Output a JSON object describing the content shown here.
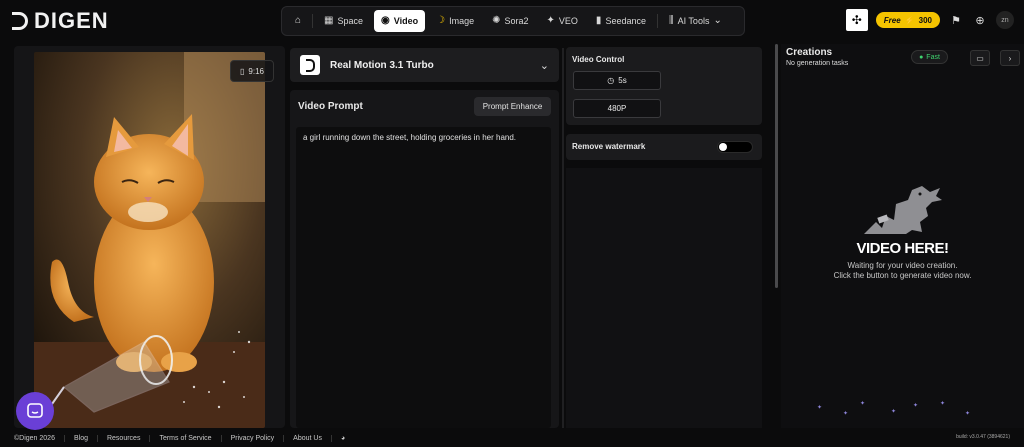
{
  "brand": {
    "name": "DIGEN"
  },
  "nav": {
    "items": [
      {
        "label": "",
        "icon": "home-icon"
      },
      {
        "label": "Space",
        "icon": "grid-icon"
      },
      {
        "label": "Video",
        "icon": "video-icon",
        "active": true
      },
      {
        "label": "Image",
        "icon": "banana-icon"
      },
      {
        "label": "Sora2",
        "icon": "sora-icon"
      },
      {
        "label": "VEO",
        "icon": "veo-icon"
      },
      {
        "label": "Seedance",
        "icon": "bars-icon"
      },
      {
        "label": "AI Tools",
        "icon": "tools-icon"
      }
    ]
  },
  "header": {
    "free_label": "Free",
    "credits": "300",
    "avatar_initials": "zn"
  },
  "preview": {
    "ratio": "9:16"
  },
  "model": {
    "name": "Real Motion 3.1 Turbo"
  },
  "prompt": {
    "title": "Video Prompt",
    "enhance_label": "Prompt Enhance",
    "text": "a girl running down the street, holding groceries in her hand."
  },
  "video_control": {
    "title": "Video Control",
    "duration": "5s",
    "resolution": "480P",
    "watermark_label": "Remove watermark",
    "watermark_enabled": false
  },
  "creations": {
    "title": "Creations",
    "subtitle": "No generation tasks",
    "speed_label": "Fast",
    "placeholder_title": "VIDEO HERE!",
    "placeholder_line1": "Waiting for your video creation.",
    "placeholder_line2": "Click the button to generate video now."
  },
  "footer": {
    "links": [
      "©Digen 2026",
      "Blog",
      "Resources",
      "Terms of Service",
      "Privacy Policy",
      "About Us"
    ],
    "build": "build: v3.0.47 (3894621)"
  },
  "colors": {
    "accent": "#f5c400",
    "fast": "#3fd46f",
    "chat": "#6a3fd6"
  }
}
